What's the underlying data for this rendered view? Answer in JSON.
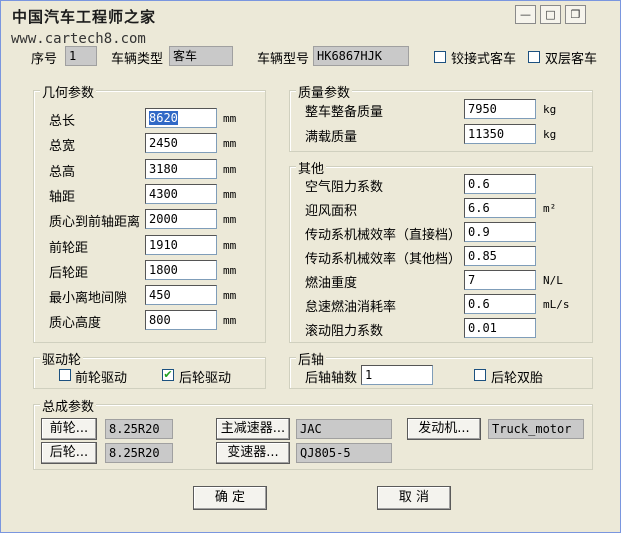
{
  "window": {
    "title": "中国汽车工程师之家",
    "watermark": "www.cartech8.com"
  },
  "header": {
    "seq_label": "序号",
    "seq_value": "1",
    "vehicle_type_label": "车辆类型",
    "vehicle_type_value": "客车",
    "model_label": "车辆型号",
    "model_value": "HK6867HJK",
    "articulated_label": "铰接式客车",
    "double_deck_label": "双层客车"
  },
  "geometry": {
    "title": "几何参数",
    "rows": [
      {
        "label": "总长",
        "value": "8620",
        "unit": "mm"
      },
      {
        "label": "总宽",
        "value": "2450",
        "unit": "mm"
      },
      {
        "label": "总高",
        "value": "3180",
        "unit": "mm"
      },
      {
        "label": "轴距",
        "value": "4300",
        "unit": "mm"
      },
      {
        "label": "质心到前轴距离",
        "value": "2000",
        "unit": "mm"
      },
      {
        "label": "前轮距",
        "value": "1910",
        "unit": "mm"
      },
      {
        "label": "后轮距",
        "value": "1800",
        "unit": "mm"
      },
      {
        "label": "最小离地间隙",
        "value": "450",
        "unit": "mm"
      },
      {
        "label": "质心高度",
        "value": "800",
        "unit": "mm"
      }
    ]
  },
  "mass": {
    "title": "质量参数",
    "rows": [
      {
        "label": "整车整备质量",
        "value": "7950",
        "unit": "kg"
      },
      {
        "label": "满载质量",
        "value": "11350",
        "unit": "kg"
      }
    ]
  },
  "other": {
    "title": "其他",
    "rows": [
      {
        "label": "空气阻力系数",
        "value": "0.6",
        "unit": ""
      },
      {
        "label": "迎风面积",
        "value": "6.6",
        "unit": "m²"
      },
      {
        "label": "传动系机械效率（直接档）",
        "value": "0.9",
        "unit": ""
      },
      {
        "label": "传动系机械效率（其他档）",
        "value": "0.85",
        "unit": ""
      },
      {
        "label": "燃油重度",
        "value": "7",
        "unit": "N/L"
      },
      {
        "label": "怠速燃油消耗率",
        "value": "0.6",
        "unit": "mL/s"
      },
      {
        "label": "滚动阻力系数",
        "value": "0.01",
        "unit": ""
      }
    ]
  },
  "drive": {
    "title": "驱动轮",
    "front_label": "前轮驱动",
    "front_checked": false,
    "rear_label": "后轮驱动",
    "rear_checked": true
  },
  "rear_axle": {
    "title": "后轴",
    "count_label": "后轴轴数",
    "count_value": "1",
    "dual_label": "后轮双胎"
  },
  "assembly": {
    "title": "总成参数",
    "front_wheel_button": "前轮...",
    "front_wheel_value": "8.25R20",
    "rear_wheel_button": "后轮...",
    "rear_wheel_value": "8.25R20",
    "final_drive_button": "主减速器...",
    "final_drive_value": "JAC",
    "gearbox_button": "变速器...",
    "gearbox_value": "QJ805-5",
    "engine_button": "发动机...",
    "engine_value": "Truck_motor"
  },
  "footer": {
    "ok_label": "确  定",
    "cancel_label": "取  消"
  }
}
